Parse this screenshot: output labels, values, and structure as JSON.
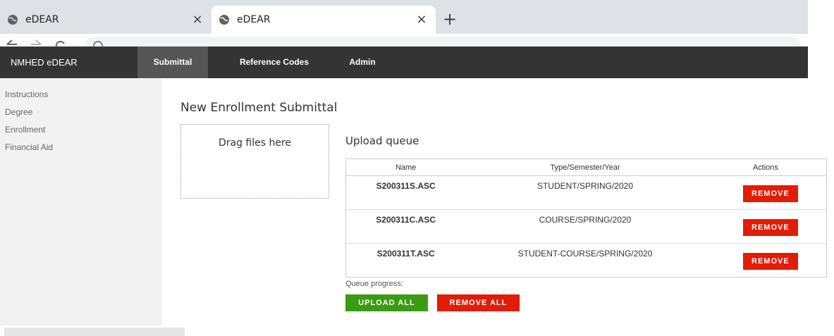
{
  "browser": {
    "tabs": [
      {
        "title": "eDEAR",
        "active": false,
        "icon": "globe-icon"
      },
      {
        "title": "eDEAR",
        "active": true,
        "icon": "globe-icon"
      }
    ],
    "close_glyph": "×",
    "newtab_glyph": "+"
  },
  "nav": {
    "brand": "NMHED eDEAR",
    "items": [
      {
        "label": "Submittal",
        "active": true
      },
      {
        "label": "Reference Codes",
        "active": false
      },
      {
        "label": "Admin",
        "active": false
      }
    ]
  },
  "sidebar": {
    "items": [
      {
        "label": "Instructions"
      },
      {
        "label": "Degree"
      },
      {
        "label": "Enrollment"
      },
      {
        "label": "Financial Aid"
      }
    ]
  },
  "main": {
    "title": "New Enrollment Submittal",
    "dropzone_text": "Drag files here",
    "queue_title": "Upload queue",
    "table": {
      "headers": [
        "Name",
        "Type/Semester/Year",
        "Actions"
      ],
      "rows": [
        {
          "name": "S200311S.ASC",
          "type": "STUDENT/SPRING/2020",
          "action": "REMOVE"
        },
        {
          "name": "S200311C.ASC",
          "type": "COURSE/SPRING/2020",
          "action": "REMOVE"
        },
        {
          "name": "S200311T.ASC",
          "type": "STUDENT-COURSE/SPRING/2020",
          "action": "REMOVE"
        }
      ]
    },
    "queue_progress_label": "Queue progress:",
    "upload_all_label": "UPLOAD ALL",
    "remove_all_label": "REMOVE ALL"
  },
  "colors": {
    "nav_bg": "#343434",
    "nav_active_bg": "#555555",
    "sidebar_bg": "#f2f2f2",
    "remove_red": "#e21c07",
    "upload_green": "#3a9c11"
  }
}
